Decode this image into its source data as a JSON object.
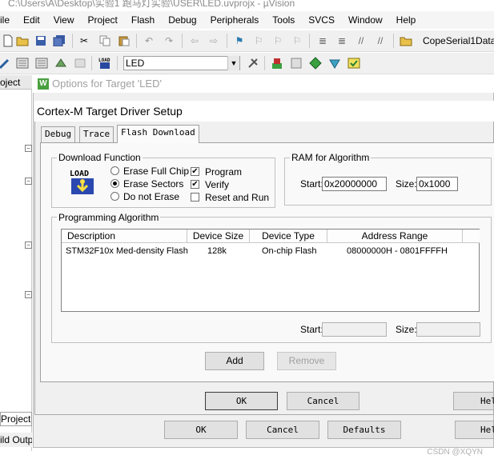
{
  "window": {
    "title": "C:\\Users\\A\\Desktop\\实验1 跑马灯实验\\USER\\LED.uvprojx - µVision"
  },
  "menu": [
    "ile",
    "Edit",
    "View",
    "Project",
    "Flash",
    "Debug",
    "Peripherals",
    "Tools",
    "SVCS",
    "Window",
    "Help"
  ],
  "toolbar1": {
    "find_text": "CopeSerial1Data"
  },
  "toolbar2": {
    "target_select": "LED"
  },
  "project_panel": {
    "top_label": "oject",
    "bottom_tab": "Project",
    "build_output": "ild Outp"
  },
  "options_dialog": {
    "title": "Options for Target 'LED'",
    "ok": "OK",
    "cancel": "Cancel",
    "defaults": "Defaults",
    "help": "Hel"
  },
  "driver_dialog": {
    "title": "Cortex-M Target Driver Setup",
    "tabs": [
      "Debug",
      "Trace",
      "Flash Download"
    ],
    "active_tab": "Flash Download",
    "download_function": {
      "label": "Download Function",
      "icon_text": "LOAD",
      "options": [
        "Erase Full Chip",
        "Erase Sectors",
        "Do not Erase"
      ],
      "selected": "Erase Sectors",
      "checks": [
        {
          "label": "Program",
          "checked": true
        },
        {
          "label": "Verify",
          "checked": true
        },
        {
          "label": "Reset and Run",
          "checked": false
        }
      ]
    },
    "ram": {
      "label": "RAM for Algorithm",
      "start_label": "Start:",
      "start": "0x20000000",
      "size_label": "Size:",
      "size": "0x1000"
    },
    "programming": {
      "label": "Programming Algorithm",
      "columns": [
        "Description",
        "Device Size",
        "Device Type",
        "Address Range"
      ],
      "rows": [
        {
          "description": "STM32F10x Med-density Flash",
          "size": "128k",
          "type": "On-chip Flash",
          "range": "08000000H - 0801FFFFH"
        }
      ],
      "start_label": "Start:",
      "size_label": "Size:"
    },
    "add": "Add",
    "remove": "Remove",
    "ok": "OK",
    "cancel": "Cancel",
    "help": "Hel"
  },
  "watermark": "CSDN @XQYN",
  "colors": {
    "dialog_bg": "#f0f0f0",
    "keil_icon": "#4aa040"
  }
}
